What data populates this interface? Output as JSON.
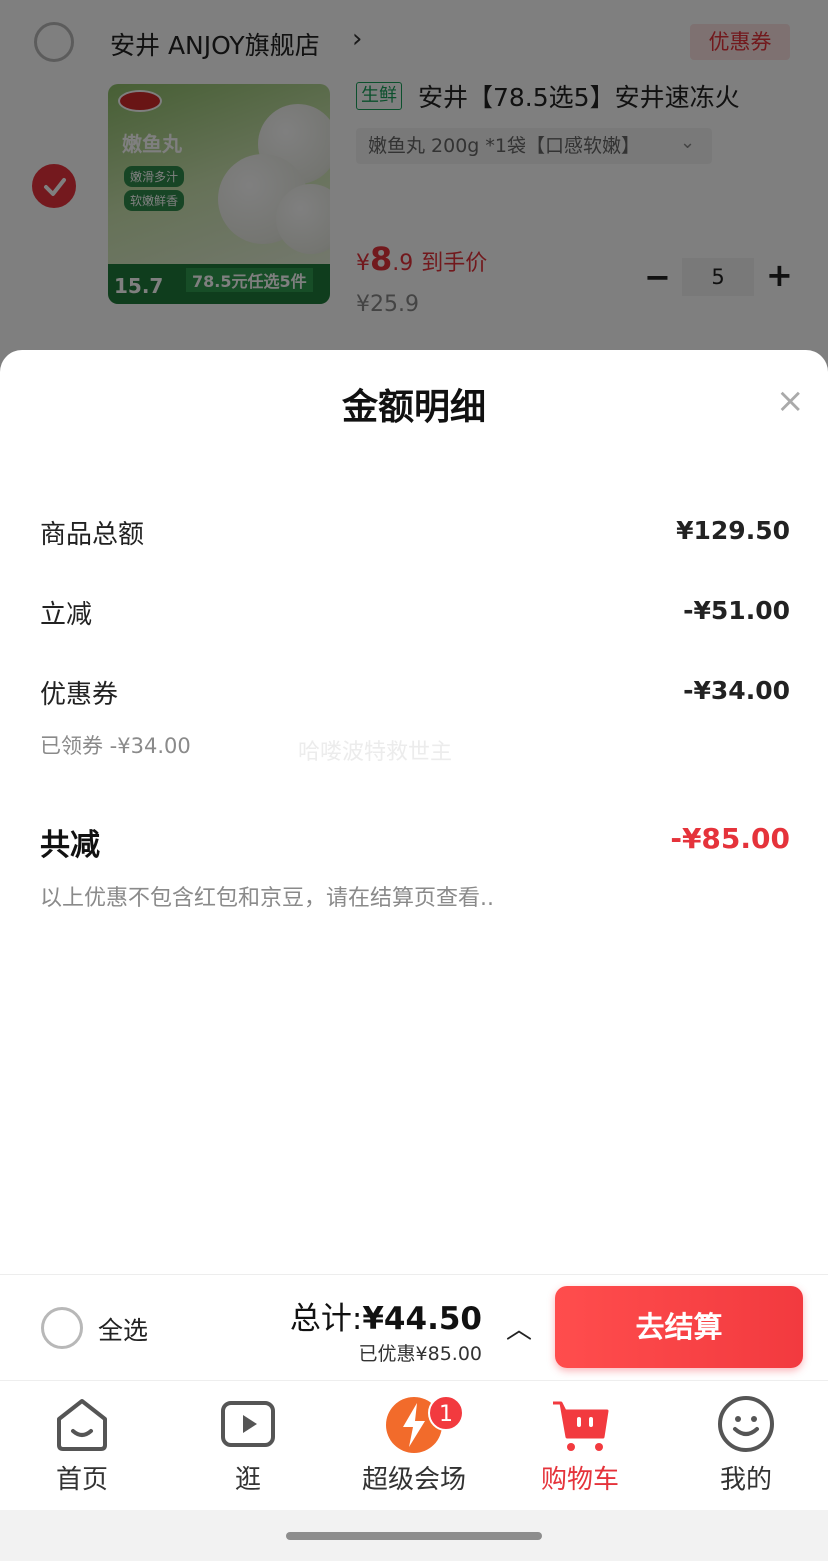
{
  "cart_item": {
    "shop_name": "安井 ANJOY旗舰店",
    "shop_arrow": "›",
    "coupon_tag": "优惠券",
    "fresh_tag": "生鲜",
    "title": "安井【78.5选5】安井速冻火",
    "variant": "嫩鱼丸 200g *1袋【口感软嫩】",
    "variant_chevron": "⌄",
    "price_symbol": "¥",
    "price_int": "8",
    "price_dec": ".9",
    "price_label": "到手价",
    "original_price": "¥25.9",
    "quantity": "5",
    "minus": "−",
    "plus": "+",
    "checked": true,
    "image": {
      "title": "嫩鱼丸",
      "tags": [
        "嫩滑多汁",
        "软嫩鲜香"
      ],
      "price": "15.7",
      "band_text": "78.5元任选5件"
    }
  },
  "sheet": {
    "title": "金额明细",
    "close": "×",
    "rows": [
      {
        "label": "商品总额",
        "value": "¥129.50"
      },
      {
        "label": "立减",
        "value": "-¥51.00"
      },
      {
        "label": "优惠券",
        "value": "-¥34.00"
      }
    ],
    "coupon_sub": "已领券 -¥34.00",
    "watermark": "哈喽波特救世主",
    "total_label": "共减",
    "total_value": "-¥85.00",
    "note": "以上优惠不包含红包和京豆，请在结算页查看.."
  },
  "checkout": {
    "select_all": "全选",
    "total_prefix": "总计:",
    "total_value": "¥44.50",
    "saved": "已优惠¥85.00",
    "caret": "︿",
    "button": "去结算"
  },
  "tabs": [
    {
      "label": "首页",
      "icon": "home-icon"
    },
    {
      "label": "逛",
      "icon": "video-icon"
    },
    {
      "label": "超级会场",
      "icon": "super-venue-icon",
      "badge": "1"
    },
    {
      "label": "购物车",
      "icon": "cart-icon",
      "active": true
    },
    {
      "label": "我的",
      "icon": "profile-icon"
    }
  ],
  "colors": {
    "accent": "#e5333b",
    "fresh": "#19a05a",
    "overlay": "rgba(0,0,0,0.5)"
  }
}
